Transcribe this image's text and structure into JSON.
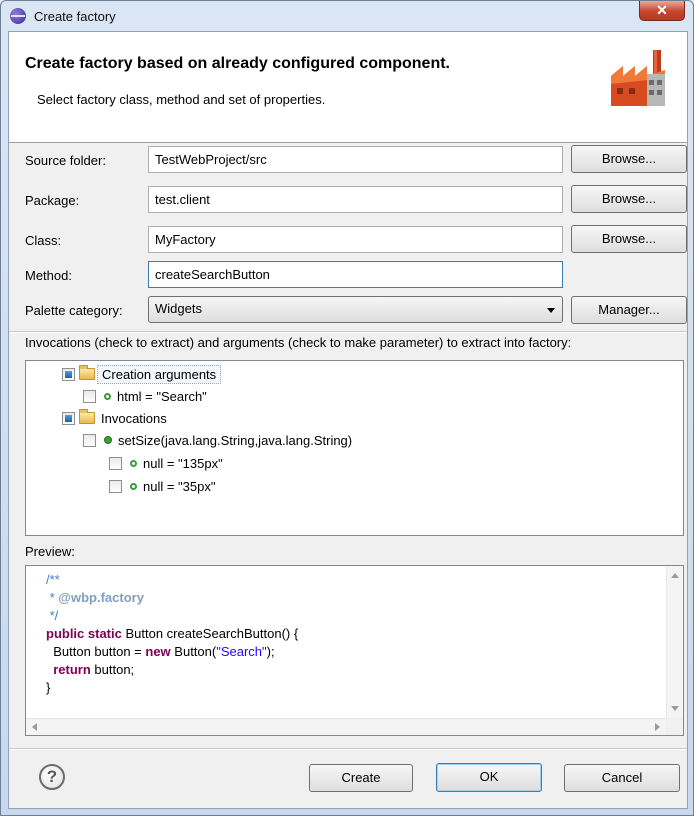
{
  "window": {
    "title": "Create factory",
    "close_glyph": "✕"
  },
  "header": {
    "title": "Create factory based on already configured component.",
    "description": "Select factory class, method and set of properties.",
    "icon": "factory-icon"
  },
  "form": {
    "source_folder": {
      "label": "Source folder:",
      "value": "TestWebProject/src",
      "button": "Browse..."
    },
    "package": {
      "label": "Package:",
      "value": "test.client",
      "button": "Browse..."
    },
    "class": {
      "label": "Class:",
      "value": "MyFactory",
      "button": "Browse..."
    },
    "method": {
      "label": "Method:",
      "value": "createSearchButton"
    },
    "palette_category": {
      "label": "Palette category:",
      "value": "Widgets",
      "button": "Manager..."
    }
  },
  "invocations": {
    "label": "Invocations (check to extract) and arguments (check to make parameter) to extract into factory:",
    "tree": [
      {
        "text": "Creation arguments",
        "icon": "folder-icon",
        "checked": "partial",
        "selected": true
      },
      {
        "text": "html = \"Search\"",
        "icon": "field-icon",
        "checked": false
      },
      {
        "text": "Invocations",
        "icon": "folder-icon",
        "checked": "partial"
      },
      {
        "text": "setSize(java.lang.String,java.lang.String)",
        "icon": "method-icon",
        "checked": false
      },
      {
        "text": "null = \"135px\"",
        "icon": "field-icon",
        "checked": false
      },
      {
        "text": "null = \"35px\"",
        "icon": "field-icon",
        "checked": false
      }
    ]
  },
  "preview": {
    "label": "Preview:",
    "code": {
      "l1": "/**",
      "l2_prefix": " * ",
      "l2_tag": "@wbp.factory",
      "l3": " */",
      "l4_kw": "public static",
      "l4_rest": " Button createSearchButton() {",
      "l5_a": "  Button button = ",
      "l5_kw": "new",
      "l5_b": " Button(",
      "l5_str": "\"Search\"",
      "l5_c": ");",
      "l6_kw": "  return",
      "l6_rest": " button;",
      "l7": "}"
    }
  },
  "footer": {
    "help": "?",
    "create": "Create",
    "ok": "OK",
    "cancel": "Cancel"
  },
  "colors": {
    "keyword": "#7f0055",
    "string": "#2a00ff",
    "comment": "#3f7fbf",
    "method_dot": "#35a535"
  }
}
